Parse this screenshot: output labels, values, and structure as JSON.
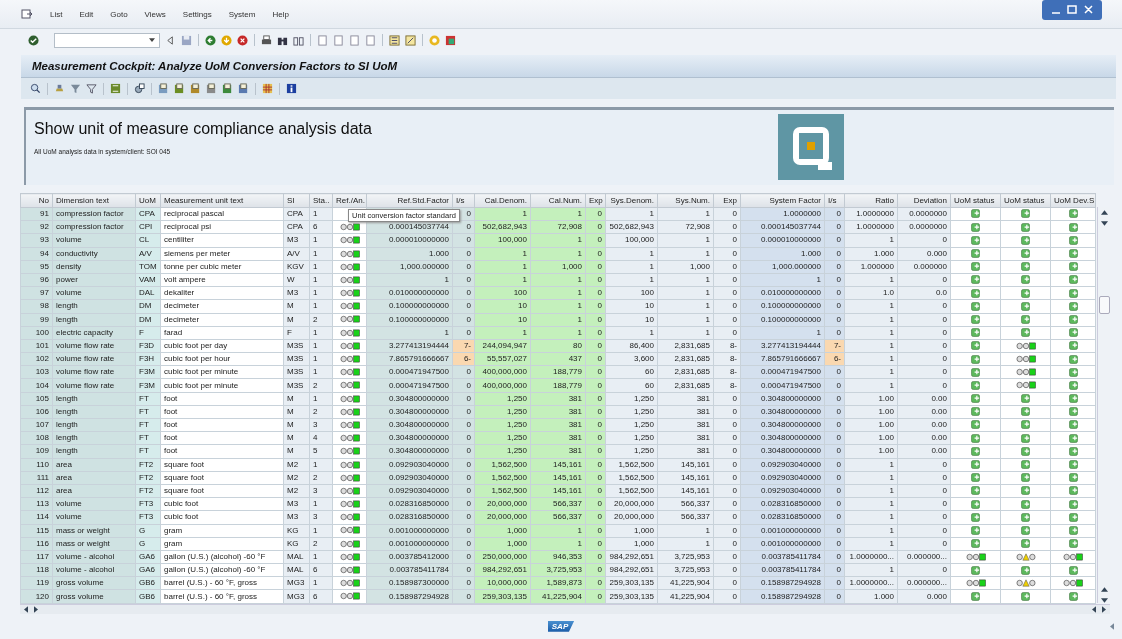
{
  "menu": [
    "List",
    "Edit",
    "Goto",
    "Views",
    "Settings",
    "System",
    "Help"
  ],
  "title": "Measurement Cockpit: Analyze UoM Conversion Factors to SI UoM",
  "header": {
    "heading": "Show unit of measure compliance analysis data",
    "subtitle": "All UoM analysis data in system/client: SOI 045"
  },
  "tooltip": "Unit conversion factor standard",
  "footer_logo": "SAP",
  "table": {
    "columns": [
      {
        "label": "No",
        "kind": "number"
      },
      {
        "label": "Dimension text",
        "kind": "text"
      },
      {
        "label": "UoM",
        "kind": "text"
      },
      {
        "label": "Measurement unit text",
        "kind": "text"
      },
      {
        "label": "SI",
        "kind": "text"
      },
      {
        "label": "Sta..",
        "kind": "text"
      },
      {
        "label": "Ref./An.",
        "kind": "light"
      },
      {
        "label": "Ref.Std.Factor",
        "kind": "number"
      },
      {
        "label": "I/s",
        "kind": "exponent"
      },
      {
        "label": "Cal.Denom.",
        "kind": "number"
      },
      {
        "label": "Cal.Num.",
        "kind": "number"
      },
      {
        "label": "Exp",
        "kind": "number"
      },
      {
        "label": "Sys.Denom.",
        "kind": "number"
      },
      {
        "label": "Sys.Num.",
        "kind": "number"
      },
      {
        "label": "Exp",
        "kind": "number"
      },
      {
        "label": "System Factor",
        "kind": "number"
      },
      {
        "label": "I/s",
        "kind": "exponent"
      },
      {
        "label": "Ratio",
        "kind": "number"
      },
      {
        "label": "Deviation",
        "kind": "number"
      },
      {
        "label": "UoM status",
        "kind": "light"
      },
      {
        "label": "UoM status",
        "kind": "light"
      },
      {
        "label": "UoM Dev.S",
        "kind": "light"
      }
    ],
    "rows": [
      {
        "cells": [
          "91",
          "compression factor",
          "CPA",
          "reciprocal pascal",
          "CPA",
          "1",
          "",
          "",
          "0",
          "1",
          "1",
          "0",
          "1",
          "1",
          "0",
          "1.0000000",
          "0",
          "1.0000000",
          "0.0000000",
          {
            "kind": "ok"
          },
          {
            "kind": "ok"
          },
          {
            "kind": "ok"
          }
        ],
        "warn": false
      },
      {
        "cells": [
          "92",
          "compression factor",
          "CPI",
          "reciprocal psi",
          "CPA",
          "6",
          {
            "kind": "green"
          },
          "0.000145037744",
          "0",
          "502,682,943",
          "72,908",
          "0",
          "502,682,943",
          "72,908",
          "0",
          "0.000145037744",
          "0",
          "1.0000000",
          "0.0000000",
          {
            "kind": "ok"
          },
          {
            "kind": "ok"
          },
          {
            "kind": "ok"
          }
        ],
        "warn": false
      },
      {
        "cells": [
          "93",
          "volume",
          "CL",
          "centiliter",
          "M3",
          "1",
          {
            "kind": "green"
          },
          "0.000010000000",
          "0",
          "100,000",
          "1",
          "0",
          "100,000",
          "1",
          "0",
          "0.000010000000",
          "0",
          "1",
          "0",
          {
            "kind": "ok"
          },
          {
            "kind": "ok"
          },
          {
            "kind": "ok"
          }
        ],
        "warn": false
      },
      {
        "cells": [
          "94",
          "conductivity",
          "A/V",
          "siemens per meter",
          "A/V",
          "1",
          {
            "kind": "green"
          },
          "1.000",
          "0",
          "1",
          "1",
          "0",
          "1",
          "1",
          "0",
          "1.000",
          "0",
          "1.000",
          "0.000",
          {
            "kind": "ok"
          },
          {
            "kind": "ok"
          },
          {
            "kind": "ok"
          }
        ],
        "warn": false
      },
      {
        "cells": [
          "95",
          "density",
          "TOM",
          "tonne per cubic meter",
          "KGV",
          "1",
          {
            "kind": "green"
          },
          "1,000.000000",
          "0",
          "1",
          "1,000",
          "0",
          "1",
          "1,000",
          "0",
          "1,000.000000",
          "0",
          "1.000000",
          "0.000000",
          {
            "kind": "ok"
          },
          {
            "kind": "ok"
          },
          {
            "kind": "ok"
          }
        ],
        "warn": false
      },
      {
        "cells": [
          "96",
          "power",
          "VAM",
          "volt ampere",
          "W",
          "1",
          {
            "kind": "green"
          },
          "1",
          "0",
          "1",
          "1",
          "0",
          "1",
          "1",
          "0",
          "1",
          "0",
          "1",
          "0",
          {
            "kind": "ok"
          },
          {
            "kind": "ok"
          },
          {
            "kind": "ok"
          }
        ],
        "warn": false
      },
      {
        "cells": [
          "97",
          "volume",
          "DAL",
          "dekaliter",
          "M3",
          "1",
          {
            "kind": "green"
          },
          "0.010000000000",
          "0",
          "100",
          "1",
          "0",
          "100",
          "1",
          "0",
          "0.010000000000",
          "0",
          "1.0",
          "0.0",
          {
            "kind": "ok"
          },
          {
            "kind": "ok"
          },
          {
            "kind": "ok"
          }
        ],
        "warn": false
      },
      {
        "cells": [
          "98",
          "length",
          "DM",
          "decimeter",
          "M",
          "1",
          {
            "kind": "green"
          },
          "0.100000000000",
          "0",
          "10",
          "1",
          "0",
          "10",
          "1",
          "0",
          "0.100000000000",
          "0",
          "1",
          "0",
          {
            "kind": "ok"
          },
          {
            "kind": "ok"
          },
          {
            "kind": "ok"
          }
        ],
        "warn": false
      },
      {
        "cells": [
          "99",
          "length",
          "DM",
          "decimeter",
          "M",
          "2",
          {
            "kind": "green"
          },
          "0.100000000000",
          "0",
          "10",
          "1",
          "0",
          "10",
          "1",
          "0",
          "0.100000000000",
          "0",
          "1",
          "0",
          {
            "kind": "ok"
          },
          {
            "kind": "ok"
          },
          {
            "kind": "ok"
          }
        ],
        "warn": false
      },
      {
        "cells": [
          "100",
          "electric capacity",
          "F",
          "farad",
          "F",
          "1",
          {
            "kind": "green"
          },
          "1",
          "0",
          "1",
          "1",
          "0",
          "1",
          "1",
          "0",
          "1",
          "0",
          "1",
          "0",
          {
            "kind": "ok"
          },
          {
            "kind": "ok"
          },
          {
            "kind": "ok"
          }
        ],
        "warn": false
      },
      {
        "cells": [
          "101",
          "volume flow rate",
          "F3D",
          "cubic foot per day",
          "M3S",
          "1",
          {
            "kind": "green"
          },
          "3.277413194444",
          "7-",
          "244,094,947",
          "80",
          "0",
          "86,400",
          "2,831,685",
          "8-",
          "3.277413194444",
          "7-",
          "1",
          "0",
          {
            "kind": "ok"
          },
          {
            "kind": "green"
          },
          {
            "kind": "ok"
          }
        ],
        "warn": true
      },
      {
        "cells": [
          "102",
          "volume flow rate",
          "F3H",
          "cubic foot per hour",
          "M3S",
          "1",
          {
            "kind": "green"
          },
          "7.865791666667",
          "6-",
          "55,557,027",
          "437",
          "0",
          "3,600",
          "2,831,685",
          "8-",
          "7.865791666667",
          "6-",
          "1",
          "0",
          {
            "kind": "ok"
          },
          {
            "kind": "green"
          },
          {
            "kind": "ok"
          }
        ],
        "warn": true
      },
      {
        "cells": [
          "103",
          "volume flow rate",
          "F3M",
          "cubic foot per minute",
          "M3S",
          "1",
          {
            "kind": "green"
          },
          "0.000471947500",
          "0",
          "400,000,000",
          "188,779",
          "0",
          "60",
          "2,831,685",
          "8-",
          "0.000471947500",
          "0",
          "1",
          "0",
          {
            "kind": "ok"
          },
          {
            "kind": "green"
          },
          {
            "kind": "ok"
          }
        ],
        "warn": false
      },
      {
        "cells": [
          "104",
          "volume flow rate",
          "F3M",
          "cubic foot per minute",
          "M3S",
          "2",
          {
            "kind": "green"
          },
          "0.000471947500",
          "0",
          "400,000,000",
          "188,779",
          "0",
          "60",
          "2,831,685",
          "8-",
          "0.000471947500",
          "0",
          "1",
          "0",
          {
            "kind": "ok"
          },
          {
            "kind": "green"
          },
          {
            "kind": "ok"
          }
        ],
        "warn": false
      },
      {
        "cells": [
          "105",
          "length",
          "FT",
          "foot",
          "M",
          "1",
          {
            "kind": "green"
          },
          "0.304800000000",
          "0",
          "1,250",
          "381",
          "0",
          "1,250",
          "381",
          "0",
          "0.304800000000",
          "0",
          "1.00",
          "0.00",
          {
            "kind": "ok"
          },
          {
            "kind": "ok"
          },
          {
            "kind": "ok"
          }
        ],
        "warn": false
      },
      {
        "cells": [
          "106",
          "length",
          "FT",
          "foot",
          "M",
          "2",
          {
            "kind": "green"
          },
          "0.304800000000",
          "0",
          "1,250",
          "381",
          "0",
          "1,250",
          "381",
          "0",
          "0.304800000000",
          "0",
          "1.00",
          "0.00",
          {
            "kind": "ok"
          },
          {
            "kind": "ok"
          },
          {
            "kind": "ok"
          }
        ],
        "warn": false
      },
      {
        "cells": [
          "107",
          "length",
          "FT",
          "foot",
          "M",
          "3",
          {
            "kind": "green"
          },
          "0.304800000000",
          "0",
          "1,250",
          "381",
          "0",
          "1,250",
          "381",
          "0",
          "0.304800000000",
          "0",
          "1.00",
          "0.00",
          {
            "kind": "ok"
          },
          {
            "kind": "ok"
          },
          {
            "kind": "ok"
          }
        ],
        "warn": false
      },
      {
        "cells": [
          "108",
          "length",
          "FT",
          "foot",
          "M",
          "4",
          {
            "kind": "green"
          },
          "0.304800000000",
          "0",
          "1,250",
          "381",
          "0",
          "1,250",
          "381",
          "0",
          "0.304800000000",
          "0",
          "1.00",
          "0.00",
          {
            "kind": "ok"
          },
          {
            "kind": "ok"
          },
          {
            "kind": "ok"
          }
        ],
        "warn": false
      },
      {
        "cells": [
          "109",
          "length",
          "FT",
          "foot",
          "M",
          "5",
          {
            "kind": "green"
          },
          "0.304800000000",
          "0",
          "1,250",
          "381",
          "0",
          "1,250",
          "381",
          "0",
          "0.304800000000",
          "0",
          "1.00",
          "0.00",
          {
            "kind": "ok"
          },
          {
            "kind": "ok"
          },
          {
            "kind": "ok"
          }
        ],
        "warn": false
      },
      {
        "cells": [
          "110",
          "area",
          "FT2",
          "square foot",
          "M2",
          "1",
          {
            "kind": "green"
          },
          "0.092903040000",
          "0",
          "1,562,500",
          "145,161",
          "0",
          "1,562,500",
          "145,161",
          "0",
          "0.092903040000",
          "0",
          "1",
          "0",
          {
            "kind": "ok"
          },
          {
            "kind": "ok"
          },
          {
            "kind": "ok"
          }
        ],
        "warn": false
      },
      {
        "cells": [
          "111",
          "area",
          "FT2",
          "square foot",
          "M2",
          "2",
          {
            "kind": "green"
          },
          "0.092903040000",
          "0",
          "1,562,500",
          "145,161",
          "0",
          "1,562,500",
          "145,161",
          "0",
          "0.092903040000",
          "0",
          "1",
          "0",
          {
            "kind": "ok"
          },
          {
            "kind": "ok"
          },
          {
            "kind": "ok"
          }
        ],
        "warn": false
      },
      {
        "cells": [
          "112",
          "area",
          "FT2",
          "square foot",
          "M2",
          "3",
          {
            "kind": "green"
          },
          "0.092903040000",
          "0",
          "1,562,500",
          "145,161",
          "0",
          "1,562,500",
          "145,161",
          "0",
          "0.092903040000",
          "0",
          "1",
          "0",
          {
            "kind": "ok"
          },
          {
            "kind": "ok"
          },
          {
            "kind": "ok"
          }
        ],
        "warn": false
      },
      {
        "cells": [
          "113",
          "volume",
          "FT3",
          "cubic foot",
          "M3",
          "1",
          {
            "kind": "green"
          },
          "0.028316850000",
          "0",
          "20,000,000",
          "566,337",
          "0",
          "20,000,000",
          "566,337",
          "0",
          "0.028316850000",
          "0",
          "1",
          "0",
          {
            "kind": "ok"
          },
          {
            "kind": "ok"
          },
          {
            "kind": "ok"
          }
        ],
        "warn": false
      },
      {
        "cells": [
          "114",
          "volume",
          "FT3",
          "cubic foot",
          "M3",
          "3",
          {
            "kind": "green"
          },
          "0.028316850000",
          "0",
          "20,000,000",
          "566,337",
          "0",
          "20,000,000",
          "566,337",
          "0",
          "0.028316850000",
          "0",
          "1",
          "0",
          {
            "kind": "ok"
          },
          {
            "kind": "ok"
          },
          {
            "kind": "ok"
          }
        ],
        "warn": false
      },
      {
        "cells": [
          "115",
          "mass or weight",
          "G",
          "gram",
          "KG",
          "1",
          {
            "kind": "green"
          },
          "0.001000000000",
          "0",
          "1,000",
          "1",
          "0",
          "1,000",
          "1",
          "0",
          "0.001000000000",
          "0",
          "1",
          "0",
          {
            "kind": "ok"
          },
          {
            "kind": "ok"
          },
          {
            "kind": "ok"
          }
        ],
        "warn": false
      },
      {
        "cells": [
          "116",
          "mass or weight",
          "G",
          "gram",
          "KG",
          "2",
          {
            "kind": "green"
          },
          "0.001000000000",
          "0",
          "1,000",
          "1",
          "0",
          "1,000",
          "1",
          "0",
          "0.001000000000",
          "0",
          "1",
          "0",
          {
            "kind": "ok"
          },
          {
            "kind": "ok"
          },
          {
            "kind": "ok"
          }
        ],
        "warn": false
      },
      {
        "cells": [
          "117",
          "volume - alcohol",
          "GA6",
          "gallon (U.S.) (alcohol) -60 °F",
          "MAL",
          "1",
          {
            "kind": "green"
          },
          "0.003785412000",
          "0",
          "250,000,000",
          "946,353",
          "0",
          "984,292,651",
          "3,725,953",
          "0",
          "0.003785411784",
          "0",
          "1.0000000...",
          "0.000000...",
          {
            "kind": "green"
          },
          {
            "kind": "yellow"
          },
          {
            "kind": "green"
          }
        ],
        "warn": false
      },
      {
        "cells": [
          "118",
          "volume - alcohol",
          "GA6",
          "gallon (U.S.) (alcohol) -60 °F",
          "MAL",
          "6",
          {
            "kind": "green"
          },
          "0.003785411784",
          "0",
          "984,292,651",
          "3,725,953",
          "0",
          "984,292,651",
          "3,725,953",
          "0",
          "0.003785411784",
          "0",
          "1",
          "0",
          {
            "kind": "ok"
          },
          {
            "kind": "ok"
          },
          {
            "kind": "ok"
          }
        ],
        "warn": false
      },
      {
        "cells": [
          "119",
          "gross volume",
          "GB6",
          "barrel (U.S.) - 60 °F, gross",
          "MG3",
          "1",
          {
            "kind": "green"
          },
          "0.158987300000",
          "0",
          "10,000,000",
          "1,589,873",
          "0",
          "259,303,135",
          "41,225,904",
          "0",
          "0.158987294928",
          "0",
          "1.0000000...",
          "0.000000...",
          {
            "kind": "green"
          },
          {
            "kind": "yellow"
          },
          {
            "kind": "green"
          }
        ],
        "warn": false
      },
      {
        "cells": [
          "120",
          "gross volume",
          "GB6",
          "barrel (U.S.) - 60 °F, gross",
          "MG3",
          "6",
          {
            "kind": "green"
          },
          "0.158987294928",
          "0",
          "259,303,135",
          "41,225,904",
          "0",
          "259,303,135",
          "41,225,904",
          "0",
          "0.158987294928",
          "0",
          "1.000",
          "0.000",
          {
            "kind": "ok"
          },
          {
            "kind": "ok"
          },
          {
            "kind": "ok"
          }
        ],
        "warn": false
      }
    ]
  }
}
